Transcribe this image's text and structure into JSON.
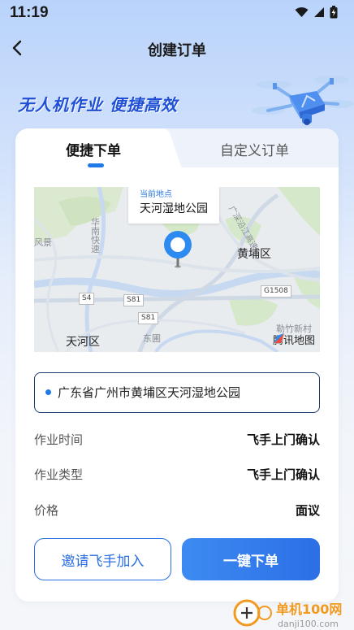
{
  "status_bar": {
    "time": "11:19"
  },
  "header": {
    "title": "创建订单"
  },
  "banner": {
    "slogan": "无人机作业  便捷高效"
  },
  "tabs": [
    {
      "label": "便捷下单",
      "active": true
    },
    {
      "label": "自定义订单",
      "active": false
    }
  ],
  "map": {
    "current_location_label": "当前地点",
    "current_location_name": "天河湿地公园",
    "labels": {
      "huangpu": "黄埔区",
      "tianhe": "天河区",
      "dongpu": "东圃",
      "qinzhu": "勒竹新村",
      "fengjing": "风景",
      "huanan_expressway": "华南快速",
      "guangshen": "广深沿江高速"
    },
    "road_badges": [
      "S4",
      "S81",
      "S81",
      "G1508"
    ],
    "provider": "腾讯地图"
  },
  "address": {
    "text": "广东省广州市黄埔区天河湿地公园"
  },
  "details": [
    {
      "label": "作业时间",
      "value": "飞手上门确认"
    },
    {
      "label": "作业类型",
      "value": "飞手上门确认"
    },
    {
      "label": "价格",
      "value": "面议"
    }
  ],
  "buttons": {
    "invite": "邀请飞手加入",
    "order": "一键下单"
  },
  "watermark": {
    "name": "单机100网",
    "url": "danji100.com"
  },
  "colors": {
    "accent": "#2c6fe6",
    "slogan": "#1f4fd4",
    "address_border": "#1c3b6e"
  }
}
